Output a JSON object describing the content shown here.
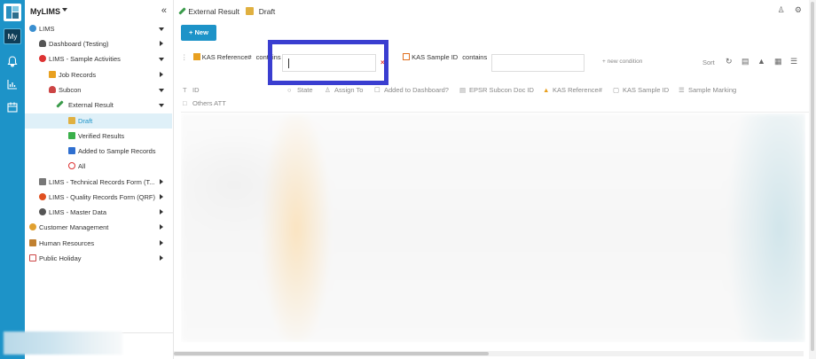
{
  "sidebar": {
    "title": "MyLIMS",
    "collapse_icon": "«",
    "items": [
      {
        "label": "LIMS",
        "icon": "globe-icon",
        "color": "#3a8fd0"
      },
      {
        "label": "Dashboard (Testing)",
        "icon": "user-icon",
        "color": "#555"
      },
      {
        "label": "LIMS - Sample Activities",
        "icon": "flask-icon",
        "color": "#d33"
      },
      {
        "label": "Job Records",
        "icon": "warning-icon",
        "color": "#e8a020"
      },
      {
        "label": "Subcon",
        "icon": "person-icon",
        "color": "#c44"
      },
      {
        "label": "External Result",
        "icon": "pencil-icon",
        "color": "#3a9b4a"
      },
      {
        "label": "Draft",
        "icon": "draft-icon",
        "color": "#e0b040"
      },
      {
        "label": "Verified Results",
        "icon": "check-icon",
        "color": "#3ab04a"
      },
      {
        "label": "Added to Sample Records",
        "icon": "folder-icon",
        "color": "#2f6fd0"
      },
      {
        "label": "All",
        "icon": "circle-icon",
        "color": "#d33"
      },
      {
        "label": "LIMS - Technical Records Form (T...",
        "icon": "tools-icon",
        "color": "#777"
      },
      {
        "label": "LIMS - Quality Records Form (QRF)",
        "icon": "award-icon",
        "color": "#e05020"
      },
      {
        "label": "LIMS - Master Data",
        "icon": "gear-icon",
        "color": "#555"
      },
      {
        "label": "Customer Management",
        "icon": "smile-icon",
        "color": "#e0a030"
      },
      {
        "label": "Human Resources",
        "icon": "people-icon",
        "color": "#c08030"
      },
      {
        "label": "Public Holiday",
        "icon": "calendar-icon",
        "color": "#c44"
      }
    ]
  },
  "rail": {
    "my_label": "My"
  },
  "breadcrumb": {
    "parent": "External Result",
    "current": "Draft"
  },
  "toolbar": {
    "new_label": "+ New"
  },
  "filters": {
    "field1": "KAS Reference#",
    "op1": "contains",
    "value1": "",
    "field2": "KAS Sample ID",
    "op2": "contains",
    "value2": "",
    "new_condition": "+ new condition",
    "sort_label": "Sort"
  },
  "columns": [
    "ID",
    "State",
    "Assign To",
    "Added to Dashboard?",
    "EPSR Subcon Doc ID",
    "KAS Reference#",
    "KAS Sample ID",
    "Sample Marking",
    "Others ATT"
  ]
}
